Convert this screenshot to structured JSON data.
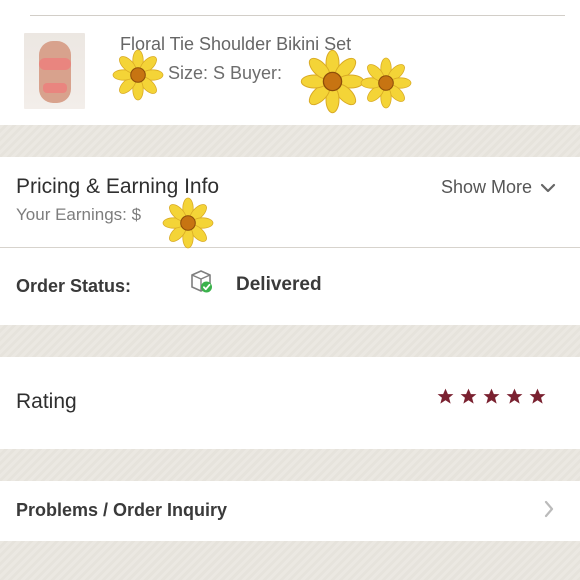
{
  "product": {
    "title": "Floral Tie Shoulder Bikini Set",
    "meta": "Size: S  Buyer:"
  },
  "pricing": {
    "title": "Pricing & Earning Info",
    "earnings_text": "Your Earnings: $",
    "show_more": "Show More",
    "show_more_icon": "chevron-down-icon"
  },
  "status": {
    "label": "Order Status:",
    "value": "Delivered",
    "icon": "delivered-box-icon"
  },
  "rating": {
    "label": "Rating",
    "stars": 5,
    "star_color": "#7a2130",
    "icon": "star-icon"
  },
  "problems": {
    "label": "Problems / Order Inquiry",
    "icon": "chevron-right-icon"
  },
  "decorations": {
    "sunflower": "sunflower-icon"
  },
  "colors": {
    "text_dark": "#2f2f2f",
    "text_muted": "#7d7d7d",
    "success": "#3bb24c",
    "star": "#7a2130",
    "background": "#ece9e3"
  }
}
